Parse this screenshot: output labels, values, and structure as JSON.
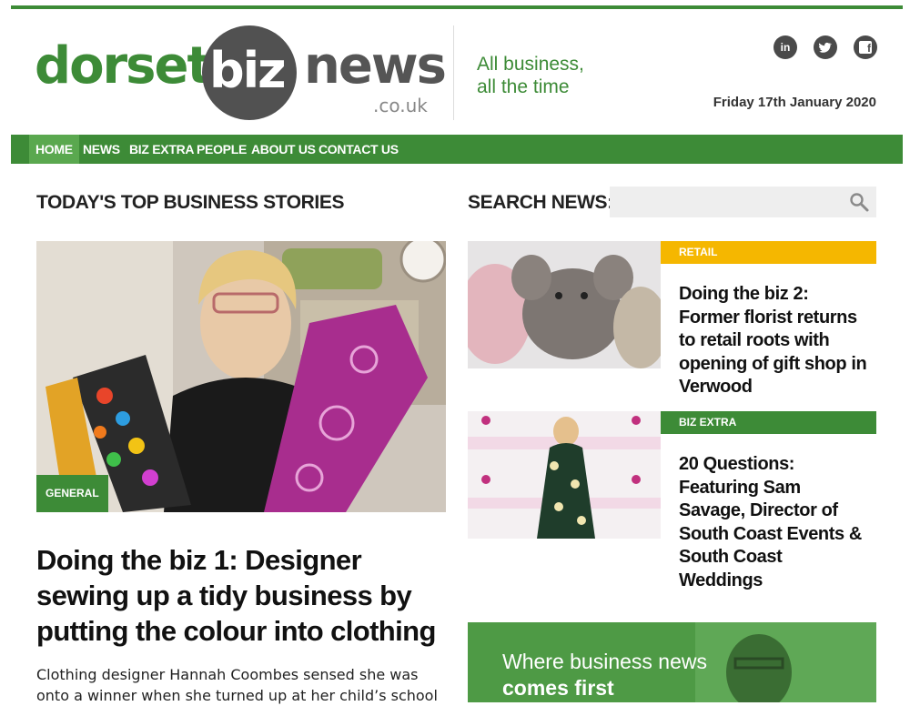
{
  "brand": {
    "logo_part1": "dorset",
    "logo_part2": "biz",
    "logo_part3": "news",
    "logo_domain": ".co.uk",
    "tagline_line1": "All business,",
    "tagline_line2": "all the time",
    "green": "#3d8b37"
  },
  "social": {
    "linkedin_label": "in",
    "twitter_label": "twitter",
    "facebook_label": "f"
  },
  "date": "Friday 17th January 2020",
  "nav": {
    "items": [
      "HOME",
      "NEWS",
      "BIZ EXTRA",
      "PEOPLE",
      "ABOUT US",
      "CONTACT US"
    ],
    "active": "HOME"
  },
  "sections": {
    "top_stories": "TODAY'S TOP BUSINESS STORIES",
    "search_label": "SEARCH NEWS:",
    "search_placeholder": ""
  },
  "feature": {
    "category": "GENERAL",
    "title": "Doing the biz 1: Designer sewing up a tidy business by putting the colour into clothing",
    "excerpt": "Clothing designer Hannah Coombes sensed she was onto a winner when she turned up at her child’s school"
  },
  "side_stories": [
    {
      "category": "RETAIL",
      "category_color": "#f5b700",
      "title": "Doing the biz 2: Former florist returns to retail roots with opening of gift shop in Verwood"
    },
    {
      "category": "BIZ EXTRA",
      "category_color": "#3d8b37",
      "title": "20 Questions: Featuring Sam Savage, Director of South Coast Events & South Coast Weddings"
    }
  ],
  "promo": {
    "line1": "Where business news",
    "line2": "comes first"
  }
}
